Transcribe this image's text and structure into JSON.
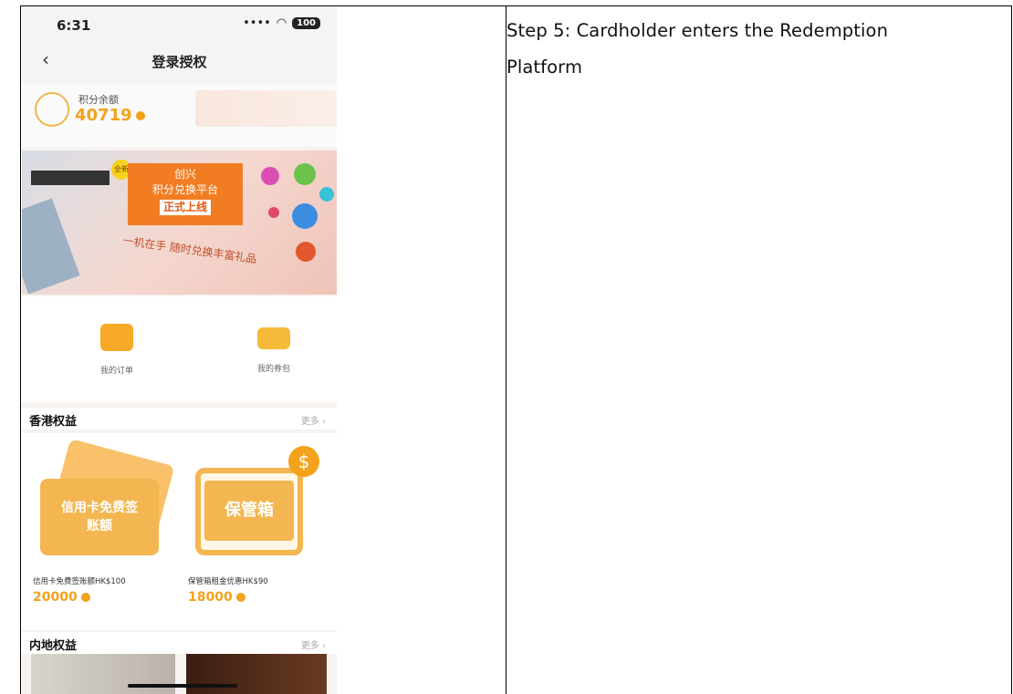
{
  "step_text": "Step 5: Cardholder enters the Redemption Platform",
  "status_bar": {
    "time": "6:31",
    "signal": "••••",
    "battery": "100"
  },
  "nav": {
    "back_icon": "‹",
    "title": "登录授权"
  },
  "points": {
    "label": "积分余额",
    "value": "40719"
  },
  "banner": {
    "badge": "全新",
    "line1": "创兴",
    "line2": "积分兑换平台",
    "line3": "正式上线",
    "sub": "一机在手 随时兑换丰富礼品"
  },
  "quick_links": [
    {
      "label": "我的订单",
      "icon": "cart-icon"
    },
    {
      "label": "我的券包",
      "icon": "coupon-icon"
    }
  ],
  "section_hk": {
    "title": "香港权益",
    "more": "更多 ›"
  },
  "products": [
    {
      "image_text": "信用卡免费签账额",
      "name": "信用卡免费签账额HK$100",
      "price": "20000"
    },
    {
      "image_text": "保管箱",
      "name": "保管箱租金优惠HK$90",
      "price": "18000"
    }
  ],
  "section_cn": {
    "title": "内地权益",
    "more": "更多 ›"
  },
  "colors": {
    "accent": "#f3a21c",
    "banner_orange": "#f27c22",
    "card": "#f3b650"
  }
}
